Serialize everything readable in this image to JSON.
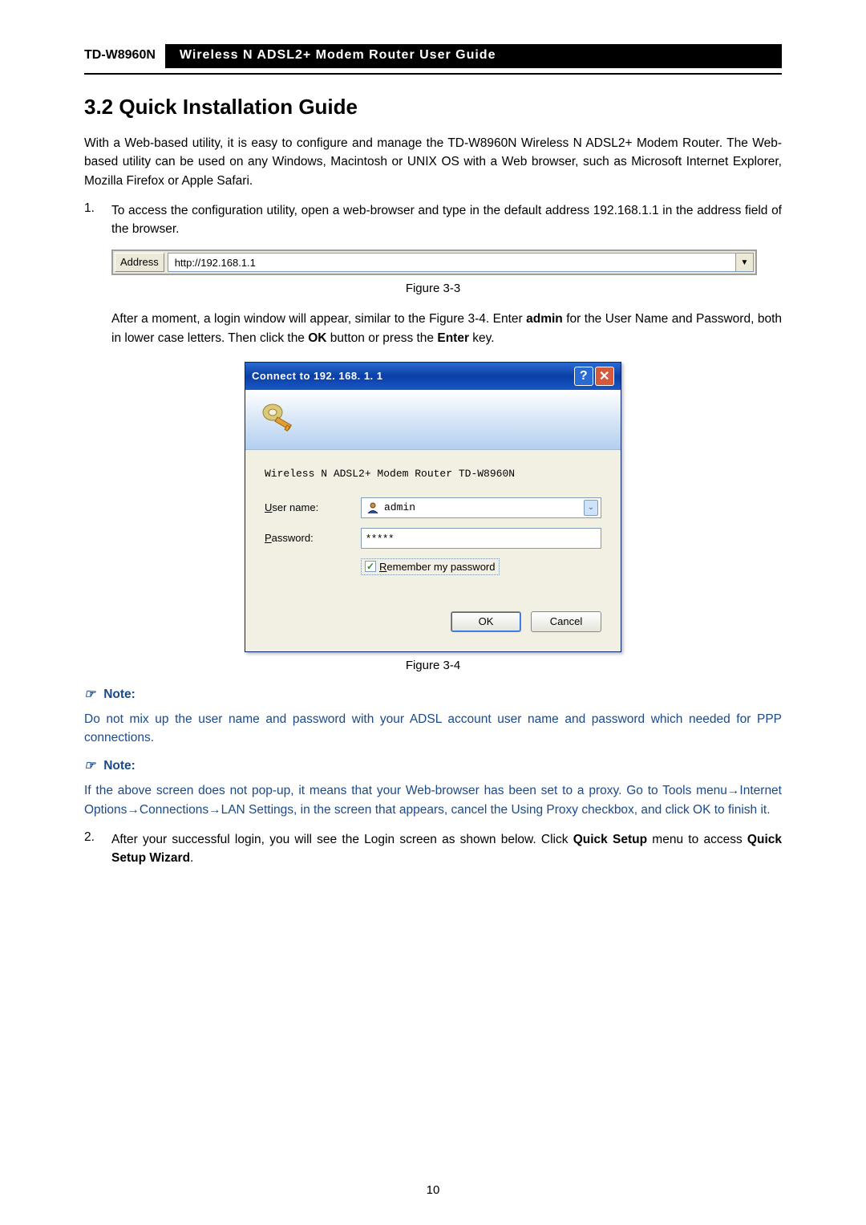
{
  "header": {
    "model": "TD-W8960N",
    "title": "Wireless N ADSL2+ Modem Router User Guide"
  },
  "section": {
    "number": "3.2",
    "title": "Quick Installation Guide"
  },
  "intro": "With a Web-based utility, it is easy to configure and manage the TD-W8960N Wireless N ADSL2+ Modem Router. The Web-based utility can be used on any Windows, Macintosh or UNIX OS with a Web browser, such as Microsoft Internet Explorer, Mozilla Firefox or Apple Safari.",
  "steps": {
    "s1_num": "1.",
    "s1_text": "To access the configuration utility, open a web-browser and type in the default address 192.168.1.1 in the address field of the browser.",
    "s1_after_a": "After a moment, a login window will appear, similar to the Figure 3-4. Enter ",
    "s1_after_b": "admin",
    "s1_after_c": " for the User Name and Password, both in lower case letters. Then click the ",
    "s1_after_d": "OK",
    "s1_after_e": " button or press the ",
    "s1_after_f": "Enter",
    "s1_after_g": " key.",
    "s2_num": "2.",
    "s2_a": "After your successful login, you will see the Login screen as shown below. Click ",
    "s2_b": "Quick Setup",
    "s2_c": " menu to access ",
    "s2_d": "Quick Setup Wizard",
    "s2_e": "."
  },
  "address_bar": {
    "label": "Address",
    "url": "http://192.168.1.1"
  },
  "fig_captions": {
    "f33": "Figure 3-3",
    "f34": "Figure 3-4"
  },
  "login_dialog": {
    "title": "Connect to 192. 168. 1. 1",
    "realm": "Wireless N ADSL2+ Modem Router TD-W8960N",
    "user_label": "User name:",
    "user_u": "U",
    "user_rest": "ser name:",
    "pass_label": "Password:",
    "pass_u": "P",
    "pass_rest": "assword:",
    "user_value": "admin",
    "pass_value": "*****",
    "remember_u": "R",
    "remember_rest": "emember my password",
    "ok": "OK",
    "cancel": "Cancel"
  },
  "notes": {
    "label": "Note:",
    "n1": "Do not mix up the user name and password with your ADSL account user name and password which needed for PPP connections.",
    "n2": "If the above screen does not pop-up, it means that your Web-browser has been set to a proxy. Go to Tools menu→Internet Options→Connections→LAN Settings, in the screen that appears, cancel the Using Proxy checkbox, and click OK to finish it."
  },
  "page_number": "10"
}
